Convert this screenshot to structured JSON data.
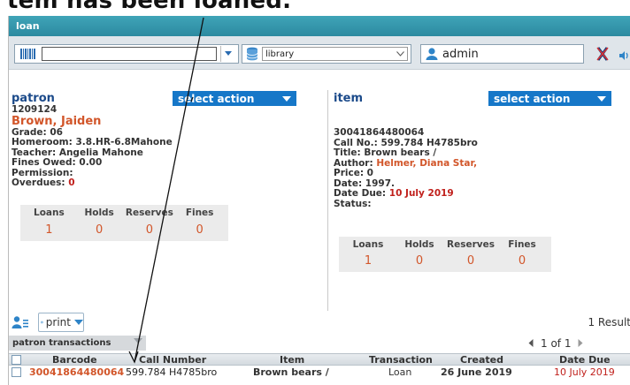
{
  "caption": "tem has been loaned.",
  "window": {
    "title": "loan"
  },
  "toolbar": {
    "barcode_value": "",
    "library_value": "library",
    "user_value": "admin"
  },
  "patron": {
    "title": "patron",
    "select_action": "select action",
    "id": "1209124",
    "name": "Brown, Jaiden",
    "grade": "Grade: 06",
    "homeroom": "Homeroom: 3.8.HR-6.8Mahone",
    "teacher": "Teacher: Angelia Mahone",
    "fines_owed": "Fines Owed: 0.00",
    "permission": "Permission:",
    "overdues_label": "Overdues:",
    "overdues_value": "0",
    "counts": {
      "labels": [
        "Loans",
        "Holds",
        "Reserves",
        "Fines"
      ],
      "values": [
        "1",
        "0",
        "0",
        "0"
      ]
    }
  },
  "item": {
    "title": "item",
    "select_action": "select action",
    "barcode": "30041864480064",
    "call_no": "Call No.: 599.784 H4785bro",
    "title_line": "Title: Brown bears /",
    "author_label": "Author:",
    "author_value": "Helmer, Diana Star,",
    "price": "Price: 0",
    "date": "Date: 1997.",
    "date_due_label": "Date Due:",
    "date_due_value": "10 July 2019",
    "status": "Status:",
    "counts": {
      "labels": [
        "Loans",
        "Holds",
        "Reserves",
        "Fines"
      ],
      "values": [
        "1",
        "0",
        "0",
        "0"
      ]
    }
  },
  "bottom": {
    "print_label": "print",
    "results": "1 Result",
    "transactions_label": "patron transactions",
    "pager": "1 of 1"
  },
  "grid": {
    "headers": [
      "Barcode",
      "Call Number",
      "Item",
      "Transaction",
      "Created",
      "Date Due"
    ],
    "rows": [
      [
        "30041864480064",
        "599.784 H4785bro",
        "Brown bears /",
        "Loan",
        "26 June 2019",
        "10 July 2019"
      ]
    ]
  },
  "colors": {
    "title_bar": "#2c8aa0",
    "accent_blue": "#1677c8",
    "orange": "#d2562a",
    "red": "#c0201c"
  }
}
